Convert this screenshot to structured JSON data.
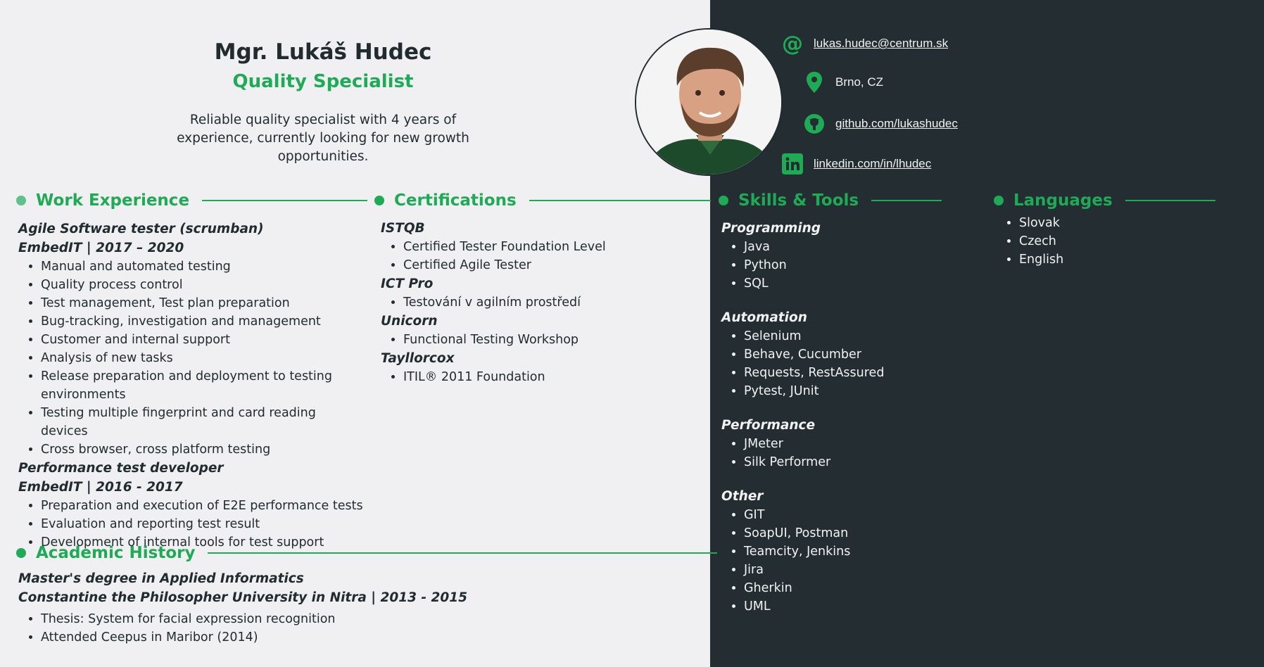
{
  "header": {
    "name": "Mgr. Lukáš Hudec",
    "title": "Quality Specialist",
    "summary": "Reliable quality specialist with 4 years of experience, currently looking for new growth opportunities."
  },
  "contacts": {
    "email": "lukas.hudec@centrum.sk",
    "location": "Brno, CZ",
    "github": "github.com/lukashudec",
    "linkedin": "linkedin.com/in/lhudec"
  },
  "sections": {
    "work": "Work Experience",
    "certs": "Certifications",
    "academic": "Academic History",
    "skills": "Skills & Tools",
    "languages": "Languages"
  },
  "work": [
    {
      "role": "Agile Software tester (scrumban)",
      "company": "EmbedIT | 2017 – 2020",
      "items": [
        "Manual and automated testing",
        "Quality process control",
        "Test management, Test plan preparation",
        "Bug-tracking, investigation and management",
        "Customer and internal support",
        "Analysis of new tasks",
        "Release preparation and deployment to testing environments",
        "Testing multiple fingerprint and card reading devices",
        "Cross browser, cross platform testing"
      ]
    },
    {
      "role": "Performance test developer",
      "company": "EmbedIT | 2016 - 2017",
      "items": [
        "Preparation and execution of E2E performance tests",
        "Evaluation and reporting test result",
        "Development of internal tools for test support"
      ]
    }
  ],
  "certifications": [
    {
      "issuer": "ISTQB",
      "items": [
        "Certified Tester Foundation Level",
        "Certified Agile Tester"
      ]
    },
    {
      "issuer": "ICT Pro",
      "items": [
        "Testování v agilním prostředí"
      ]
    },
    {
      "issuer": "Unicorn",
      "items": [
        "Functional Testing Workshop"
      ]
    },
    {
      "issuer": "Tayllorcox",
      "items": [
        "ITIL® 2011 Foundation"
      ]
    }
  ],
  "academic": {
    "degree": "Master's degree in Applied Informatics",
    "school": "Constantine the Philosopher University in Nitra | 2013 - 2015",
    "items": [
      "Thesis: System for facial expression recognition",
      "Attended Ceepus in Maribor (2014)"
    ]
  },
  "skills": [
    {
      "category": "Programming",
      "items": [
        "Java",
        "Python",
        "SQL"
      ]
    },
    {
      "category": "Automation",
      "items": [
        "Selenium",
        "Behave, Cucumber",
        "Requests, RestAssured",
        "Pytest, JUnit"
      ]
    },
    {
      "category": "Performance",
      "items": [
        "JMeter",
        "Silk Performer"
      ]
    },
    {
      "category": "Other",
      "items": [
        "GIT",
        "SoapUI, Postman",
        "Teamcity, Jenkins",
        "Jira",
        "Gherkin",
        "UML"
      ]
    }
  ],
  "languages": [
    "Slovak",
    "Czech",
    "English"
  ],
  "colors": {
    "accent": "#1faa55",
    "dark_panel": "#232d32",
    "light_panel": "#f0f0f2",
    "text_dark": "#222b30"
  }
}
